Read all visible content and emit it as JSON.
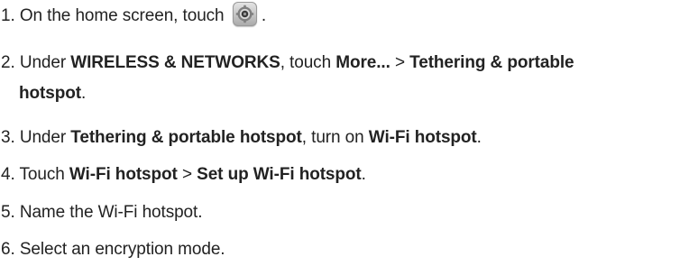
{
  "steps": [
    {
      "number": "1.",
      "text_before": " On the home screen, touch ",
      "icon": "settings-icon",
      "text_after": " ."
    },
    {
      "number": "2.",
      "text_before": " Under ",
      "bold_1": "WIRELESS & NETWORKS",
      "text_mid_1": ", touch ",
      "bold_2": "More...",
      "text_mid_2": " > ",
      "bold_3": "Tethering & portable",
      "bold_3_cont": "hotspot",
      "text_after": "."
    },
    {
      "number": "3.",
      "text_before": " Under ",
      "bold_1": "Tethering & portable hotspot",
      "text_mid_1": ", turn on ",
      "bold_2": "Wi-Fi hotspot",
      "text_after": "."
    },
    {
      "number": "4.",
      "text_before": " Touch ",
      "bold_1": "Wi-Fi hotspot",
      "text_mid_1": " > ",
      "bold_2": "Set up Wi-Fi hotspot",
      "text_after": "."
    },
    {
      "number": "5.",
      "text": " Name the Wi-Fi hotspot."
    },
    {
      "number": "6.",
      "text": " Select an encryption mode."
    }
  ]
}
